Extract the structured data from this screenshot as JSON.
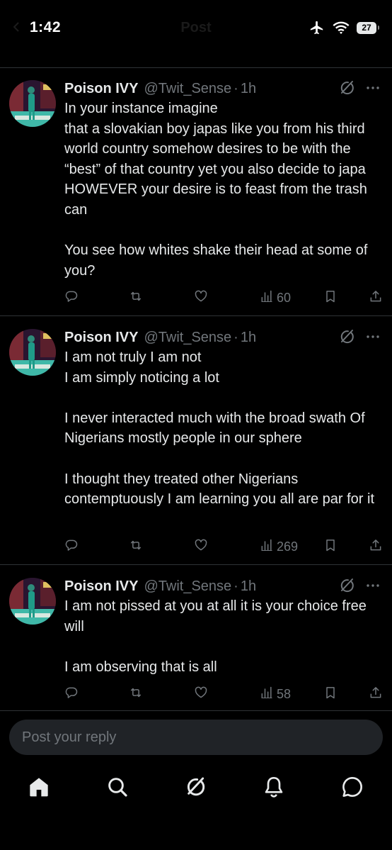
{
  "status_bar": {
    "time": "1:42",
    "faded_title": "Post",
    "battery": "27"
  },
  "tweets": [
    {
      "name": "Poison IVY",
      "handle": "@Twit_Sense",
      "separator": "·",
      "time": "1h",
      "paragraphs": [
        "In your instance imagine\nthat a slovakian boy japas like you from his third world country somehow desires to be with the “best” of that country yet you also decide to japa HOWEVER your desire is to feast from the trash can",
        "You see how whites shake their head at some of you?"
      ],
      "views": "60"
    },
    {
      "name": "Poison IVY",
      "handle": "@Twit_Sense",
      "separator": "·",
      "time": "1h",
      "paragraphs": [
        "I am not truly I am not\nI am simply noticing a lot",
        "I never interacted much with the broad swath Of Nigerians mostly people in our sphere",
        "I thought they treated other Nigerians contemptuously I am learning you all are par for it"
      ],
      "views": "269"
    },
    {
      "name": "Poison IVY",
      "handle": "@Twit_Sense",
      "separator": "·",
      "time": "1h",
      "paragraphs": [
        "I am not pissed at you at all it is your choice free will",
        "I am observing that is all"
      ],
      "views": "58"
    }
  ],
  "reply": {
    "placeholder": "Post your reply"
  },
  "nav": {
    "items": [
      "home-icon",
      "search-icon",
      "grok-icon",
      "notifications-icon",
      "messages-icon"
    ]
  },
  "colors": {
    "background": "#000000",
    "text": "#e7e9ea",
    "secondary": "#71767b",
    "divider": "#2f3336",
    "reply_bg": "#202327"
  }
}
